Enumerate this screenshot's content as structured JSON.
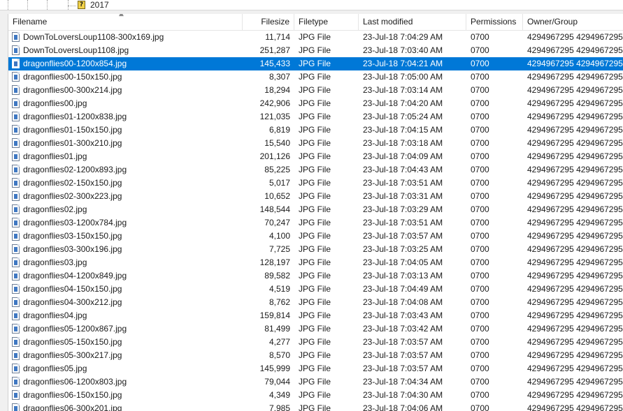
{
  "tree": {
    "folder_icon_glyph": "?",
    "folder_label": "2017"
  },
  "columns": {
    "filename": "Filename",
    "filesize": "Filesize",
    "filetype": "Filetype",
    "last_modified": "Last modified",
    "permissions": "Permissions",
    "owner_group": "Owner/Group",
    "sorted_by": "filename"
  },
  "colors": {
    "selection": "#0078d7"
  },
  "files": [
    {
      "name": "DownToLoversLoup1108-300x169.jpg",
      "size": "11,714",
      "type": "JPG File",
      "modified": "23-Jul-18 7:04:29 AM",
      "perm": "0700",
      "owner": "4294967295 4294967295",
      "selected": false
    },
    {
      "name": "DownToLoversLoup1108.jpg",
      "size": "251,287",
      "type": "JPG File",
      "modified": "23-Jul-18 7:03:40 AM",
      "perm": "0700",
      "owner": "4294967295 4294967295",
      "selected": false
    },
    {
      "name": "dragonflies00-1200x854.jpg",
      "size": "145,433",
      "type": "JPG File",
      "modified": "23-Jul-18 7:04:21 AM",
      "perm": "0700",
      "owner": "4294967295 4294967295",
      "selected": true
    },
    {
      "name": "dragonflies00-150x150.jpg",
      "size": "8,307",
      "type": "JPG File",
      "modified": "23-Jul-18 7:05:00 AM",
      "perm": "0700",
      "owner": "4294967295 4294967295",
      "selected": false
    },
    {
      "name": "dragonflies00-300x214.jpg",
      "size": "18,294",
      "type": "JPG File",
      "modified": "23-Jul-18 7:03:14 AM",
      "perm": "0700",
      "owner": "4294967295 4294967295",
      "selected": false
    },
    {
      "name": "dragonflies00.jpg",
      "size": "242,906",
      "type": "JPG File",
      "modified": "23-Jul-18 7:04:20 AM",
      "perm": "0700",
      "owner": "4294967295 4294967295",
      "selected": false
    },
    {
      "name": "dragonflies01-1200x838.jpg",
      "size": "121,035",
      "type": "JPG File",
      "modified": "23-Jul-18 7:05:24 AM",
      "perm": "0700",
      "owner": "4294967295 4294967295",
      "selected": false
    },
    {
      "name": "dragonflies01-150x150.jpg",
      "size": "6,819",
      "type": "JPG File",
      "modified": "23-Jul-18 7:04:15 AM",
      "perm": "0700",
      "owner": "4294967295 4294967295",
      "selected": false
    },
    {
      "name": "dragonflies01-300x210.jpg",
      "size": "15,540",
      "type": "JPG File",
      "modified": "23-Jul-18 7:03:18 AM",
      "perm": "0700",
      "owner": "4294967295 4294967295",
      "selected": false
    },
    {
      "name": "dragonflies01.jpg",
      "size": "201,126",
      "type": "JPG File",
      "modified": "23-Jul-18 7:04:09 AM",
      "perm": "0700",
      "owner": "4294967295 4294967295",
      "selected": false
    },
    {
      "name": "dragonflies02-1200x893.jpg",
      "size": "85,225",
      "type": "JPG File",
      "modified": "23-Jul-18 7:04:43 AM",
      "perm": "0700",
      "owner": "4294967295 4294967295",
      "selected": false
    },
    {
      "name": "dragonflies02-150x150.jpg",
      "size": "5,017",
      "type": "JPG File",
      "modified": "23-Jul-18 7:03:51 AM",
      "perm": "0700",
      "owner": "4294967295 4294967295",
      "selected": false
    },
    {
      "name": "dragonflies02-300x223.jpg",
      "size": "10,652",
      "type": "JPG File",
      "modified": "23-Jul-18 7:03:31 AM",
      "perm": "0700",
      "owner": "4294967295 4294967295",
      "selected": false
    },
    {
      "name": "dragonflies02.jpg",
      "size": "148,544",
      "type": "JPG File",
      "modified": "23-Jul-18 7:03:29 AM",
      "perm": "0700",
      "owner": "4294967295 4294967295",
      "selected": false
    },
    {
      "name": "dragonflies03-1200x784.jpg",
      "size": "70,247",
      "type": "JPG File",
      "modified": "23-Jul-18 7:03:51 AM",
      "perm": "0700",
      "owner": "4294967295 4294967295",
      "selected": false
    },
    {
      "name": "dragonflies03-150x150.jpg",
      "size": "4,100",
      "type": "JPG File",
      "modified": "23-Jul-18 7:03:57 AM",
      "perm": "0700",
      "owner": "4294967295 4294967295",
      "selected": false
    },
    {
      "name": "dragonflies03-300x196.jpg",
      "size": "7,725",
      "type": "JPG File",
      "modified": "23-Jul-18 7:03:25 AM",
      "perm": "0700",
      "owner": "4294967295 4294967295",
      "selected": false
    },
    {
      "name": "dragonflies03.jpg",
      "size": "128,197",
      "type": "JPG File",
      "modified": "23-Jul-18 7:04:05 AM",
      "perm": "0700",
      "owner": "4294967295 4294967295",
      "selected": false
    },
    {
      "name": "dragonflies04-1200x849.jpg",
      "size": "89,582",
      "type": "JPG File",
      "modified": "23-Jul-18 7:03:13 AM",
      "perm": "0700",
      "owner": "4294967295 4294967295",
      "selected": false
    },
    {
      "name": "dragonflies04-150x150.jpg",
      "size": "4,519",
      "type": "JPG File",
      "modified": "23-Jul-18 7:04:49 AM",
      "perm": "0700",
      "owner": "4294967295 4294967295",
      "selected": false
    },
    {
      "name": "dragonflies04-300x212.jpg",
      "size": "8,762",
      "type": "JPG File",
      "modified": "23-Jul-18 7:04:08 AM",
      "perm": "0700",
      "owner": "4294967295 4294967295",
      "selected": false
    },
    {
      "name": "dragonflies04.jpg",
      "size": "159,814",
      "type": "JPG File",
      "modified": "23-Jul-18 7:03:43 AM",
      "perm": "0700",
      "owner": "4294967295 4294967295",
      "selected": false
    },
    {
      "name": "dragonflies05-1200x867.jpg",
      "size": "81,499",
      "type": "JPG File",
      "modified": "23-Jul-18 7:03:42 AM",
      "perm": "0700",
      "owner": "4294967295 4294967295",
      "selected": false
    },
    {
      "name": "dragonflies05-150x150.jpg",
      "size": "4,277",
      "type": "JPG File",
      "modified": "23-Jul-18 7:03:57 AM",
      "perm": "0700",
      "owner": "4294967295 4294967295",
      "selected": false
    },
    {
      "name": "dragonflies05-300x217.jpg",
      "size": "8,570",
      "type": "JPG File",
      "modified": "23-Jul-18 7:03:57 AM",
      "perm": "0700",
      "owner": "4294967295 4294967295",
      "selected": false
    },
    {
      "name": "dragonflies05.jpg",
      "size": "145,999",
      "type": "JPG File",
      "modified": "23-Jul-18 7:03:57 AM",
      "perm": "0700",
      "owner": "4294967295 4294967295",
      "selected": false
    },
    {
      "name": "dragonflies06-1200x803.jpg",
      "size": "79,044",
      "type": "JPG File",
      "modified": "23-Jul-18 7:04:34 AM",
      "perm": "0700",
      "owner": "4294967295 4294967295",
      "selected": false
    },
    {
      "name": "dragonflies06-150x150.jpg",
      "size": "4,349",
      "type": "JPG File",
      "modified": "23-Jul-18 7:04:30 AM",
      "perm": "0700",
      "owner": "4294967295 4294967295",
      "selected": false
    },
    {
      "name": "dragonflies06-300x201.jpg",
      "size": "7,985",
      "type": "JPG File",
      "modified": "23-Jul-18 7:04:06 AM",
      "perm": "0700",
      "owner": "4294967295 4294967295",
      "selected": false
    }
  ]
}
